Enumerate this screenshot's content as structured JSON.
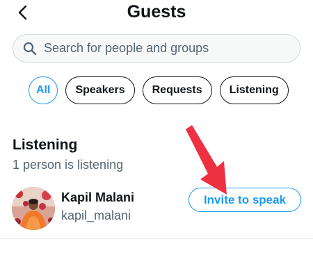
{
  "header": {
    "title": "Guests",
    "back_icon": "chevron-left-icon"
  },
  "search": {
    "placeholder": "Search for people and groups",
    "value": "",
    "icon": "search-icon"
  },
  "filters": [
    {
      "label": "All",
      "active": true
    },
    {
      "label": "Speakers",
      "active": false
    },
    {
      "label": "Requests",
      "active": false
    },
    {
      "label": "Listening",
      "active": false
    }
  ],
  "section": {
    "title": "Listening",
    "subtitle": "1 person is listening"
  },
  "people": [
    {
      "name": "Kapil Malani",
      "handle": "kapil_malani",
      "action_label": "Invite to speak"
    }
  ],
  "colors": {
    "accent": "#1d9bf0",
    "text_primary": "#0f1419",
    "text_secondary": "#536471",
    "annotation_arrow": "#ee3140"
  }
}
